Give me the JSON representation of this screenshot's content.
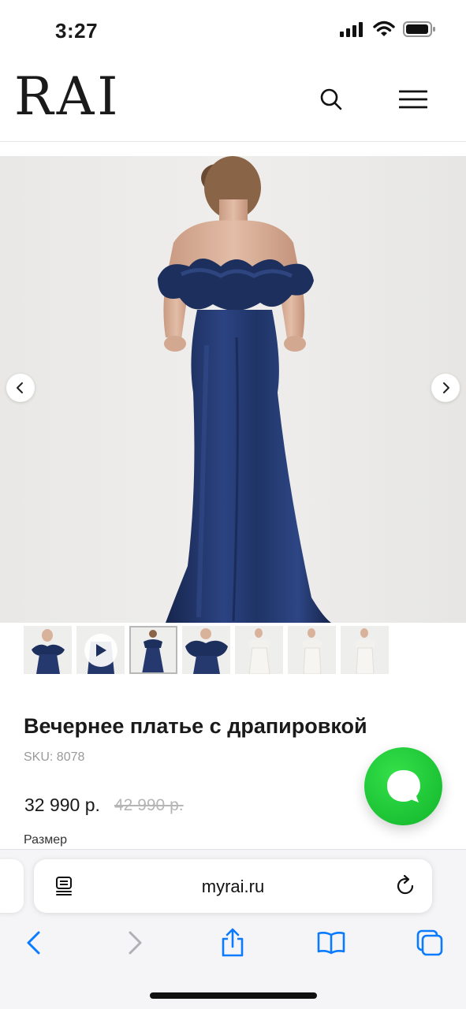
{
  "status_bar": {
    "time": "3:27"
  },
  "header": {
    "logo": "RAI",
    "icons": [
      "search-icon",
      "hamburger-menu-icon"
    ]
  },
  "gallery": {
    "thumbnail_count": 7,
    "active_thumbnail": 3,
    "video_thumbnail": 2,
    "dress_color": "#1f3466"
  },
  "product": {
    "title": "Вечернее платье с драпировкой",
    "sku": "SKU: 8078",
    "price": "32 990 р.",
    "old_price": "42 990 р.",
    "size_label": "Размер"
  },
  "chat": {
    "icon": "chat-bubble-icon",
    "color": "#19c234"
  },
  "browser": {
    "url": "myrai.ru",
    "toolbar_icons": [
      "back-icon",
      "forward-icon",
      "share-icon",
      "bookmarks-icon",
      "tabs-icon"
    ]
  },
  "colors": {
    "accent_blue": "#0a7aff",
    "disabled_gray": "#b0b0b5"
  }
}
